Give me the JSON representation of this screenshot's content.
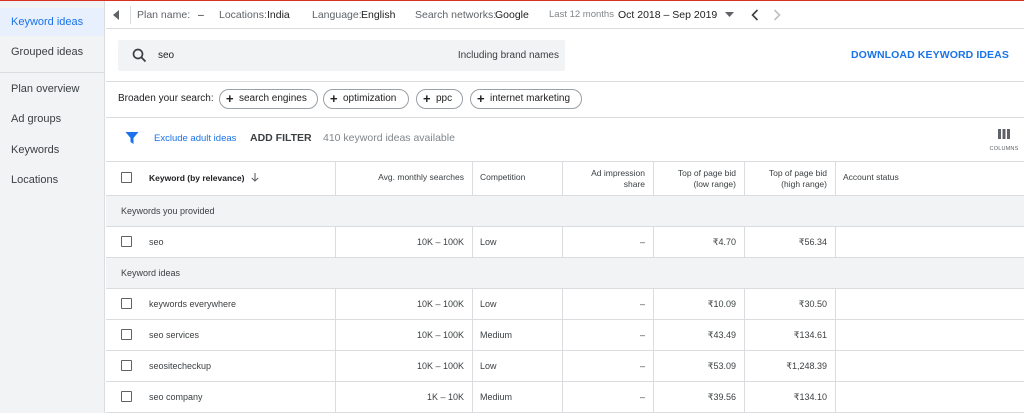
{
  "sidebar": {
    "items": [
      {
        "label": "Keyword ideas",
        "active": true
      },
      {
        "label": "Grouped ideas"
      },
      {
        "label": "Plan overview"
      },
      {
        "label": "Ad groups"
      },
      {
        "label": "Keywords"
      },
      {
        "label": "Locations"
      }
    ]
  },
  "topbar": {
    "plan_label": "Plan name:",
    "plan_value": "–",
    "locations_label": "Locations:",
    "locations_value": "India",
    "language_label": "Language:",
    "language_value": "English",
    "networks_label": "Search networks:",
    "networks_value": "Google",
    "range_label": "Last 12 months",
    "range_value": "Oct 2018 – Sep 2019"
  },
  "search": {
    "query": "seo",
    "brand_toggle": "Including brand names"
  },
  "download_label": "DOWNLOAD KEYWORD IDEAS",
  "broaden": {
    "label": "Broaden your search:",
    "chips": [
      "search engines",
      "optimization",
      "ppc",
      "internet marketing"
    ]
  },
  "filter": {
    "exclude_label": "Exclude adult ideas",
    "add_filter_label": "ADD FILTER",
    "available_text": "410 keyword ideas available",
    "columns_label": "COLUMNS"
  },
  "table": {
    "headers": {
      "keyword": "Keyword (by relevance)",
      "avg": "Avg. monthly searches",
      "competition": "Competition",
      "impression_1": "Ad impression",
      "impression_2": "share",
      "low_1": "Top of page bid",
      "low_2": "(low range)",
      "high_1": "Top of page bid",
      "high_2": "(high range)",
      "status": "Account status"
    },
    "sections": [
      {
        "title": "Keywords you provided",
        "rows": [
          {
            "keyword": "seo",
            "avg": "10K – 100K",
            "competition": "Low",
            "impression": "–",
            "low": "₹4.70",
            "high": "₹56.34"
          }
        ]
      },
      {
        "title": "Keyword ideas",
        "rows": [
          {
            "keyword": "keywords everywhere",
            "avg": "10K – 100K",
            "competition": "Low",
            "impression": "–",
            "low": "₹10.09",
            "high": "₹30.50"
          },
          {
            "keyword": "seo services",
            "avg": "10K – 100K",
            "competition": "Medium",
            "impression": "–",
            "low": "₹43.49",
            "high": "₹134.61"
          },
          {
            "keyword": "seositecheckup",
            "avg": "10K – 100K",
            "competition": "Low",
            "impression": "–",
            "low": "₹53.09",
            "high": "₹1,248.39"
          },
          {
            "keyword": "seo company",
            "avg": "1K – 10K",
            "competition": "Medium",
            "impression": "–",
            "low": "₹39.56",
            "high": "₹134.10"
          }
        ]
      }
    ]
  },
  "colors": {
    "accent": "#1a73e8",
    "sidebar_bg": "#f1f3f4",
    "active_bg": "#e8f0fe",
    "top_line": "#d93025"
  }
}
